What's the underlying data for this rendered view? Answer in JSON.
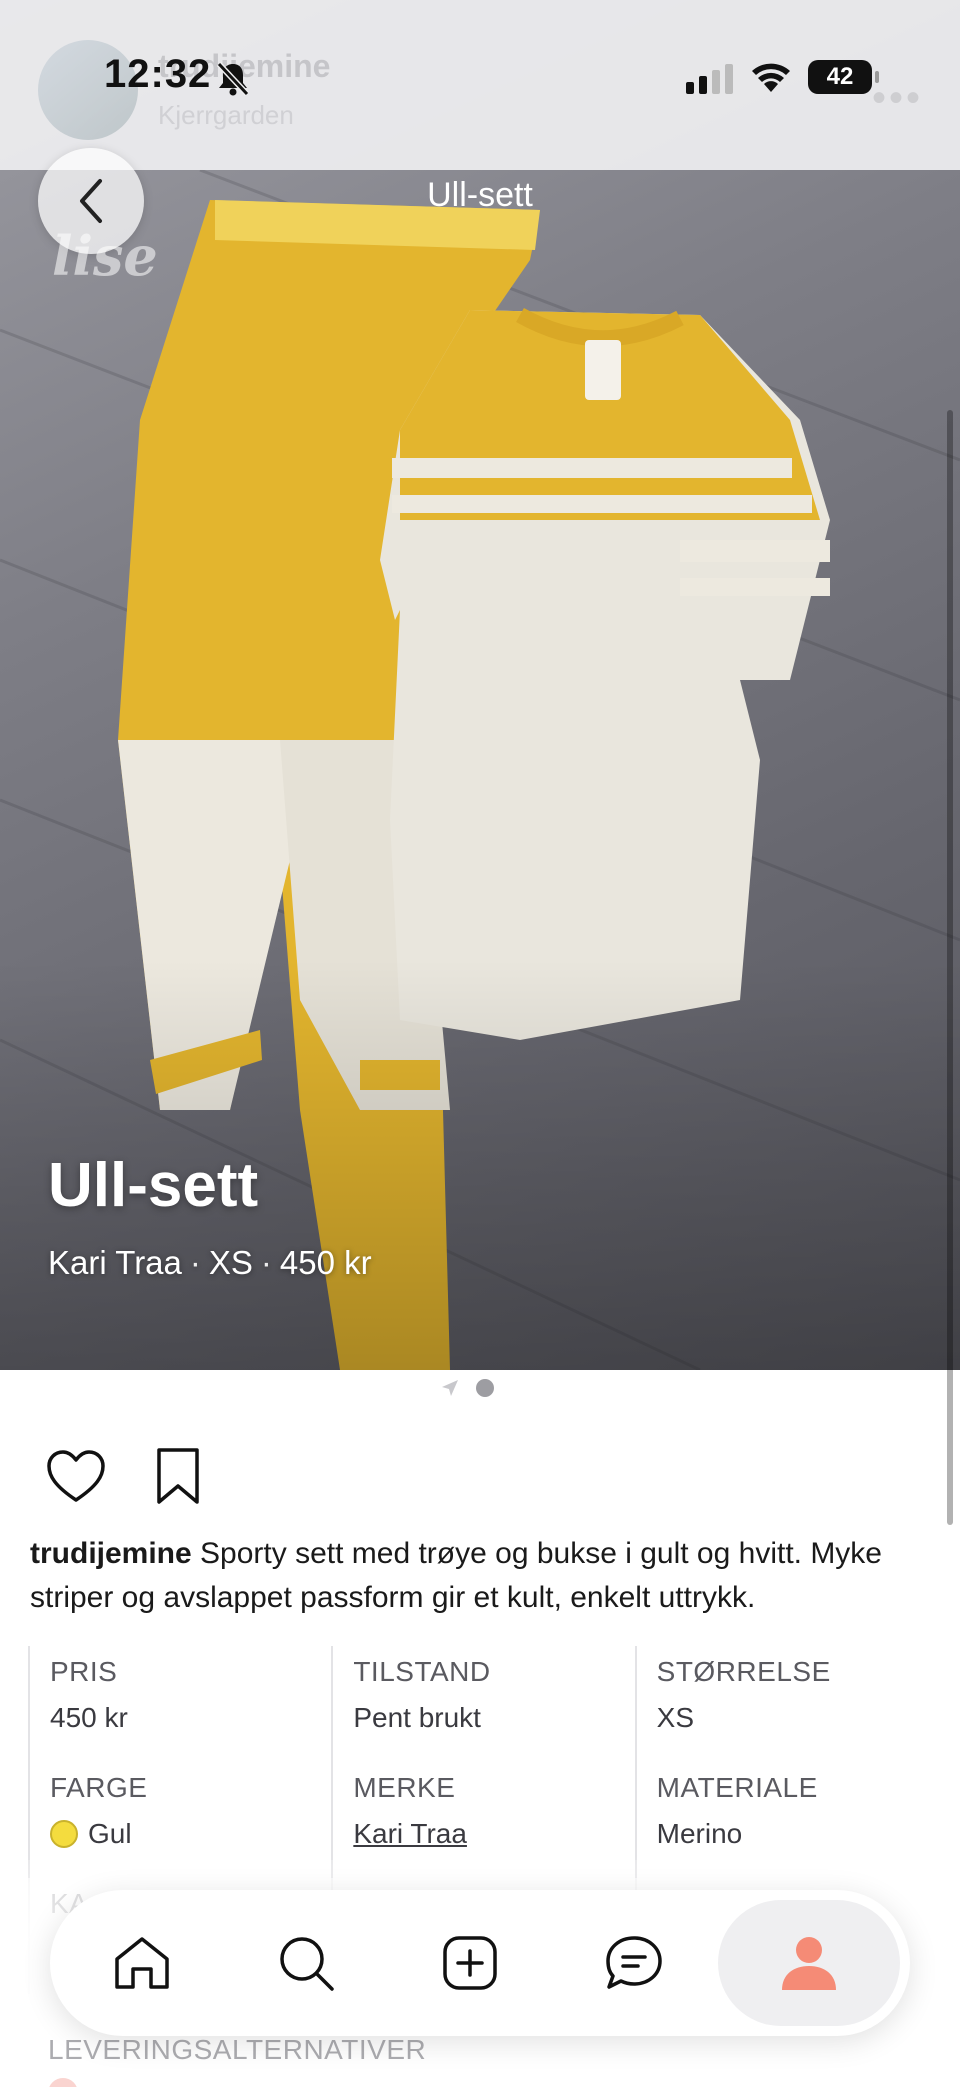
{
  "status_bar": {
    "time": "12:32",
    "battery": "42"
  },
  "header_ghost": {
    "username": "trudijemine",
    "location": "Kjerrgarden"
  },
  "nav": {
    "title": "Ull-sett"
  },
  "hero": {
    "watermark": "lise",
    "title": "Ull-sett",
    "brand": "Kari Traa",
    "separator": "·",
    "size": "XS",
    "price": "450 kr"
  },
  "pager": {
    "pages": 2,
    "current": 2
  },
  "post": {
    "username": "trudijemine",
    "description": " Sporty sett med trøye og bukse i gult og hvitt. Myke striper og avslappet passform gir et kult, enkelt uttrykk."
  },
  "details": {
    "rows": [
      [
        {
          "label": "PRIS",
          "value": "450 kr"
        },
        {
          "label": "TILSTAND",
          "value": "Pent brukt"
        },
        {
          "label": "STØRRELSE",
          "value": "XS"
        }
      ],
      [
        {
          "label": "FARGE",
          "value": "Gul",
          "color": "#f4dc3e"
        },
        {
          "label": "MERKE",
          "value": "Kari Traa"
        },
        {
          "label": "MATERIALE",
          "value": "Merino"
        }
      ],
      [
        {
          "label": "KA",
          "value": ""
        },
        {
          "label": "",
          "value": ""
        },
        {
          "label": "",
          "value": ""
        }
      ]
    ]
  },
  "delivery": {
    "label": "LEVERINGSALTERNATIVER"
  },
  "tabbar": {
    "items": [
      "home-icon",
      "search-icon",
      "add-icon",
      "messages-icon",
      "profile-icon"
    ],
    "active": "profile-icon",
    "accent": "#f58b76"
  }
}
